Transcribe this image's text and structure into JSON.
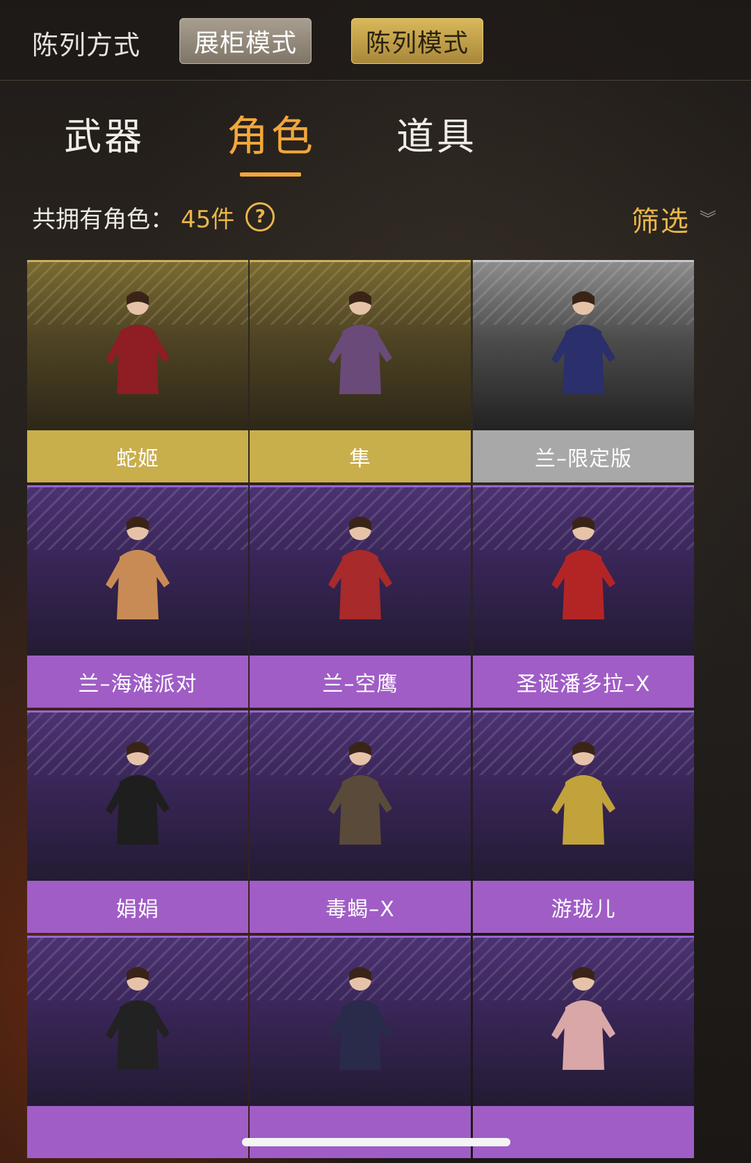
{
  "top": {
    "label": "陈列方式",
    "modes": [
      "展柜模式",
      "陈列模式"
    ]
  },
  "tabs": [
    "武器",
    "角色",
    "道具"
  ],
  "count": {
    "label": "共拥有角色：",
    "value": "45件",
    "help": "?"
  },
  "filter": {
    "label": "筛选"
  },
  "cards": [
    {
      "name": "蛇姬",
      "rarity": "gold"
    },
    {
      "name": "隼",
      "rarity": "gold"
    },
    {
      "name": "兰–限定版",
      "rarity": "silver"
    },
    {
      "name": "兰–海滩派对",
      "rarity": "purple"
    },
    {
      "name": "兰–空鹰",
      "rarity": "purple"
    },
    {
      "name": "圣诞潘多拉–X",
      "rarity": "purple"
    },
    {
      "name": "娟娟",
      "rarity": "purple"
    },
    {
      "name": "毒蝎–X",
      "rarity": "purple"
    },
    {
      "name": "游珑儿",
      "rarity": "purple"
    },
    {
      "name": "",
      "rarity": "purple"
    },
    {
      "name": "",
      "rarity": "purple"
    },
    {
      "name": "",
      "rarity": "purple"
    }
  ],
  "colors": {
    "accent": "#f2a73b",
    "gold": "#c9ae4c",
    "silver": "#a8a8a8",
    "purple": "#a05dc6"
  }
}
